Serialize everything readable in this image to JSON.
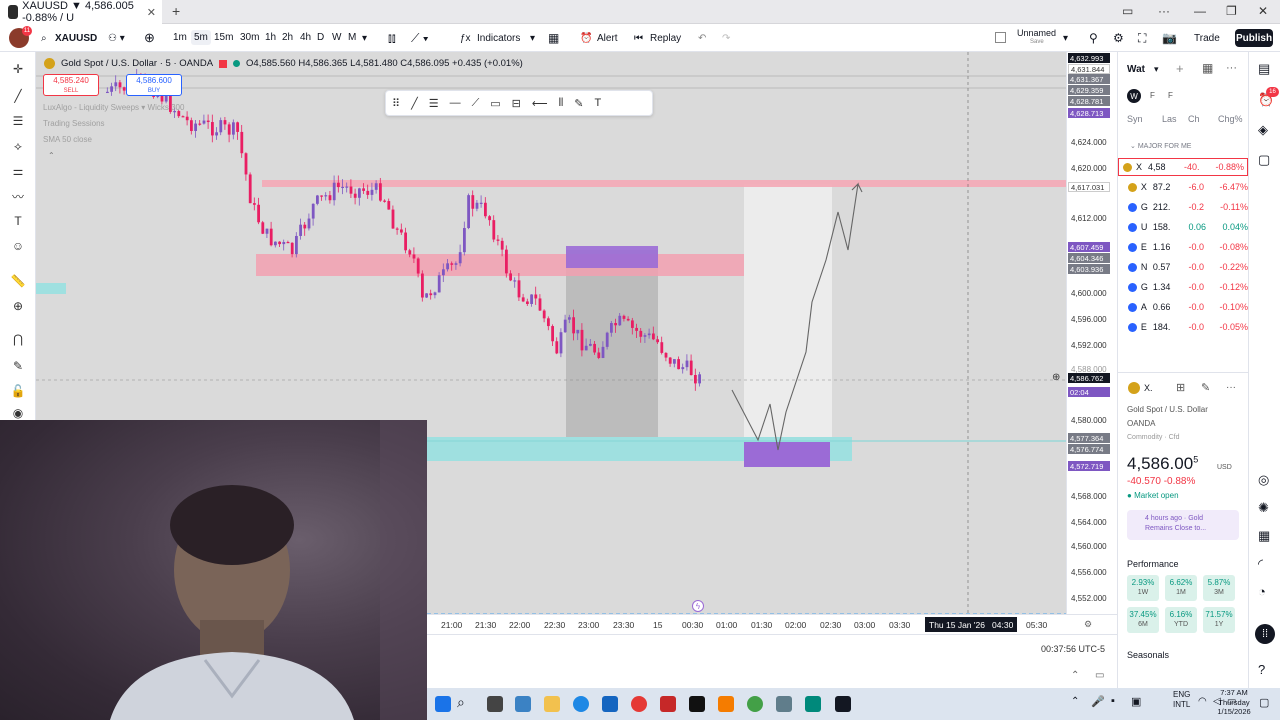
{
  "browser": {
    "tab_title": "XAUUSD ▼ 4,586.005 -0.88% / U",
    "new_tab": "+"
  },
  "toolbar": {
    "symbol": "XAUUSD",
    "timeframes": [
      "1m",
      "5m",
      "15m",
      "30m",
      "1h",
      "2h",
      "4h",
      "D",
      "W",
      "M"
    ],
    "active_timeframe": "5m",
    "indicators_label": "Indicators",
    "alert_label": "Alert",
    "replay_label": "Replay",
    "layout_name": "Unnamed",
    "layout_sub": "Save",
    "trade_label": "Trade",
    "publish_label": "Publish",
    "notification_count": "11"
  },
  "legend": {
    "title": "Gold Spot / U.S. Dollar · 5 · OANDA",
    "ohlc": "O4,585.560 H4,586.365 L4,581.480 C4,586.095 +0.435 (+0.01%)",
    "sell_price": "4,585.240",
    "sell_label": "SELL",
    "buy_price": "4,586.600",
    "buy_label": "BUY",
    "indicator1": "LuxAlgo - Liquidity Sweeps ▾ Wicks 300",
    "indicator2": "Trading Sessions",
    "indicator3": "SMA 50 close"
  },
  "price_scale": {
    "labels": [
      "4,624.000",
      "4,620.000",
      "4,612.000",
      "4,600.000",
      "4,596.000",
      "4,592.000",
      "4,588.000",
      "4,580.000",
      "4,568.000",
      "4,564.000",
      "4,560.000",
      "4,556.000",
      "4,552.000"
    ],
    "tags": [
      {
        "text": "4,632.993",
        "color": "#131722"
      },
      {
        "text": "4,631.844",
        "color": "#ffffff"
      },
      {
        "text": "4,631.367",
        "color": "#787b86"
      },
      {
        "text": "4,629.359",
        "color": "#787b86"
      },
      {
        "text": "4,628.781",
        "color": "#787b86"
      },
      {
        "text": "4,628.713",
        "color": "#7e57c2"
      },
      {
        "text": "4,617.031",
        "color": "#ffffff"
      },
      {
        "text": "4,607.459",
        "color": "#7e57c2"
      },
      {
        "text": "4,604.346",
        "color": "#787b86"
      },
      {
        "text": "4,603.936",
        "color": "#787b86"
      },
      {
        "text": "4,586.762",
        "color": "#131722"
      },
      {
        "text": "02:04",
        "color": "#7e57c2"
      },
      {
        "text": "4,577.364",
        "color": "#787b86"
      },
      {
        "text": "4,576.774",
        "color": "#787b86"
      },
      {
        "text": "4,572.719",
        "color": "#7e57c2"
      }
    ]
  },
  "time_axis": {
    "labels": [
      "21:00",
      "21:30",
      "22:00",
      "22:30",
      "23:00",
      "23:30",
      "15",
      "00:30",
      "01:00",
      "01:30",
      "02:00",
      "02:30",
      "03:00",
      "03:30",
      "05:30"
    ],
    "crosshair_label": "Thu 15 Jan '26   04:30"
  },
  "status": {
    "clock": "00:37:56 UTC-5"
  },
  "watchlist": {
    "title": "Wat",
    "tabs": [
      "W",
      "F",
      "F"
    ],
    "columns": [
      "Syn",
      "Las",
      "Ch",
      "Chg%"
    ],
    "section": "MAJOR FOR ME",
    "rows": [
      {
        "sym": "X",
        "last": "4,58",
        "ch": "-40.",
        "chp": "-0.88%",
        "dir": "neg"
      },
      {
        "sym": "X",
        "last": "87.2",
        "ch": "-6.0",
        "chp": "-6.47%",
        "dir": "neg"
      },
      {
        "sym": "G",
        "last": "212.",
        "ch": "-0.2",
        "chp": "-0.11%",
        "dir": "neg"
      },
      {
        "sym": "U",
        "last": "158.",
        "ch": "0.06",
        "chp": "0.04%",
        "dir": "pos"
      },
      {
        "sym": "E",
        "last": "1.16",
        "ch": "-0.0",
        "chp": "-0.08%",
        "dir": "neg"
      },
      {
        "sym": "N",
        "last": "0.57",
        "ch": "-0.0",
        "chp": "-0.22%",
        "dir": "neg"
      },
      {
        "sym": "G",
        "last": "1.34",
        "ch": "-0.0",
        "chp": "-0.12%",
        "dir": "neg"
      },
      {
        "sym": "A",
        "last": "0.66",
        "ch": "-0.0",
        "chp": "-0.10%",
        "dir": "neg"
      },
      {
        "sym": "E",
        "last": "184.",
        "ch": "-0.0",
        "chp": "-0.05%",
        "dir": "neg"
      }
    ]
  },
  "details": {
    "symbol": "X.",
    "name": "Gold Spot / U.S. Dollar",
    "exchange": "OANDA",
    "type": "Commodity · Cfd",
    "price_main": "4,586.00",
    "price_sup": "5",
    "currency": "USD",
    "change": "-40.570  -0.88%",
    "market_status": "Market open",
    "news_time": "4 hours ago · Gold",
    "news_text": "Remains Close to...",
    "performance_title": "Performance",
    "performance": [
      {
        "value": "2.93%",
        "period": "1W"
      },
      {
        "value": "6.62%",
        "period": "1M"
      },
      {
        "value": "5.87%",
        "period": "3M"
      },
      {
        "value": "37.45%",
        "period": "6M"
      },
      {
        "value": "6.16%",
        "period": "YTD"
      },
      {
        "value": "71.57%",
        "period": "1Y"
      }
    ],
    "seasonals_title": "Seasonals"
  },
  "taskbar": {
    "lang": "ENG",
    "lang2": "INTL",
    "time": "7:37 AM",
    "day": "Thursday",
    "date": "1/15/2026"
  },
  "right_badge": "16",
  "colors": {
    "bull": "#7e57c2",
    "bear": "#e91e63",
    "supply_zone": "#f5b5c0",
    "demand_zone": "#9fe0e0",
    "negative": "#f23645",
    "positive": "#089981"
  }
}
